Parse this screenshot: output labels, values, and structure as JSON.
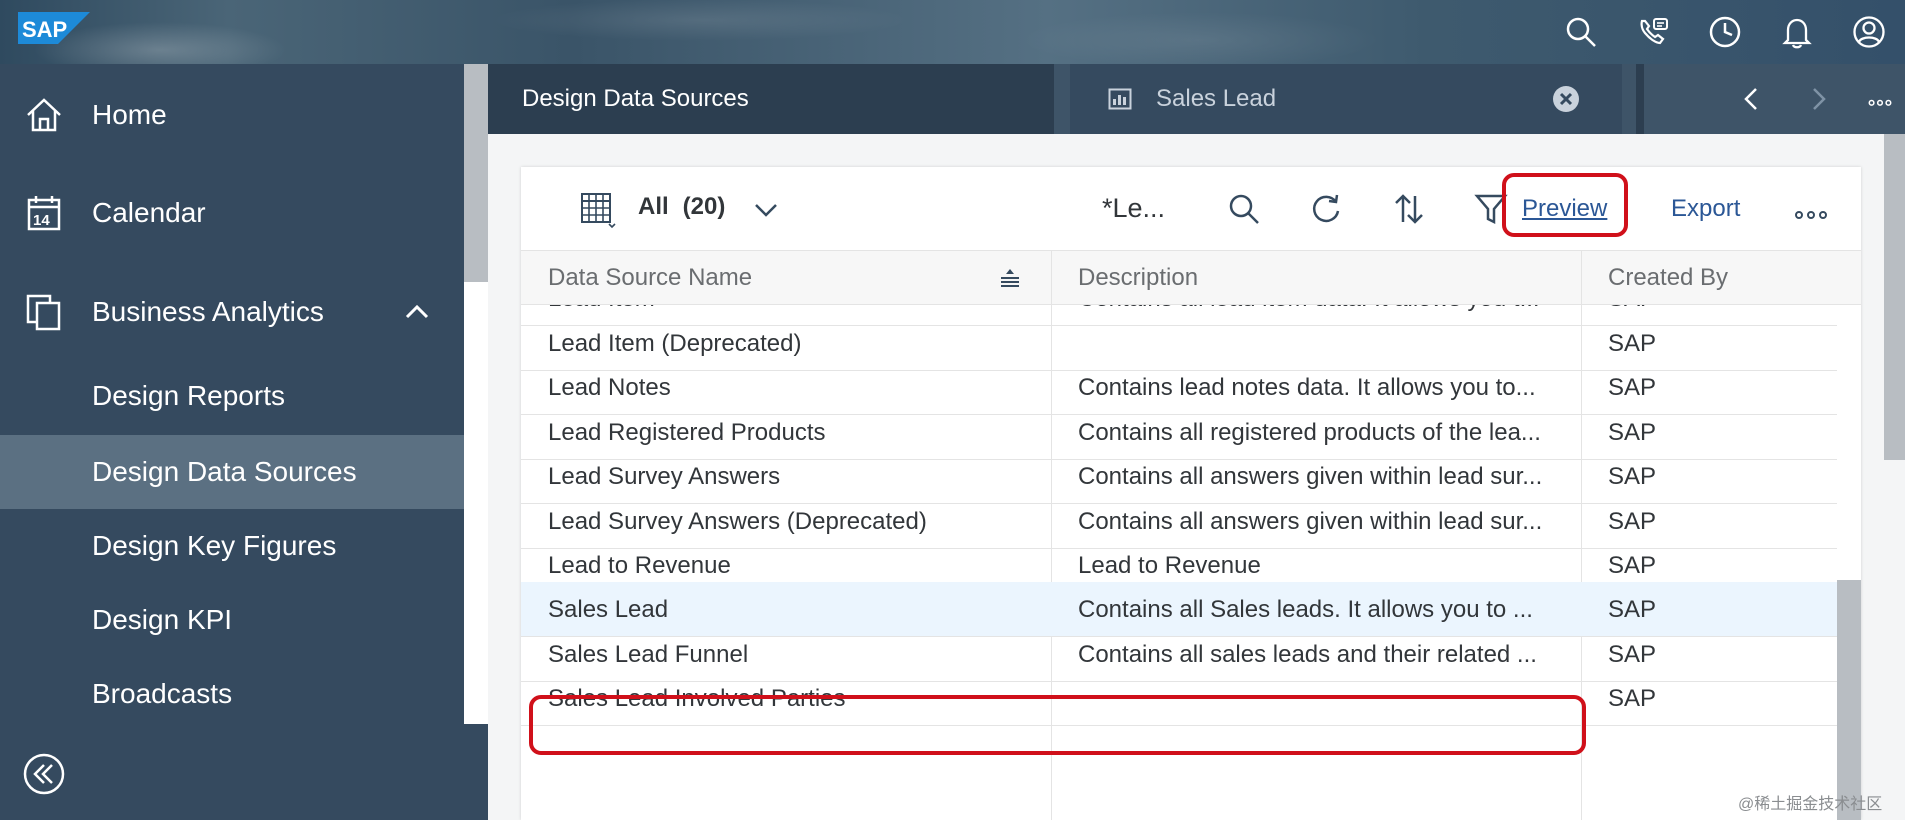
{
  "shell": {
    "logo_text": "SAP",
    "actions": [
      "search-icon",
      "feedback-icon",
      "history-icon",
      "notification-icon",
      "user-icon"
    ]
  },
  "sidebar": {
    "home": "Home",
    "calendar": "Calendar",
    "calendar_icon_day": "14",
    "business_analytics": "Business Analytics",
    "sub_items": [
      "Design Reports",
      "Design Data Sources",
      "Design Key Figures",
      "Design KPI",
      "Broadcasts"
    ],
    "selected": "Design Data Sources"
  },
  "tabs": {
    "active": "Design Data Sources",
    "second": "Sales Lead"
  },
  "toolbar": {
    "variant": "All",
    "count": "(20)",
    "search_text": "*Le...",
    "preview": "Preview",
    "export": "Export"
  },
  "table": {
    "columns": [
      "Data Source Name",
      "Description",
      "Created By"
    ],
    "rows": [
      {
        "name": "Lead Item",
        "description": "Contains all lead item data. It allows you t...",
        "created_by": "SAP"
      },
      {
        "name": "Lead Item (Deprecated)",
        "description": "",
        "created_by": "SAP"
      },
      {
        "name": "Lead Notes",
        "description": "Contains lead notes data. It allows you to...",
        "created_by": "SAP"
      },
      {
        "name": "Lead Registered Products",
        "description": "Contains all registered products of the lea...",
        "created_by": "SAP"
      },
      {
        "name": "Lead Survey Answers",
        "description": "Contains all answers given within lead sur...",
        "created_by": "SAP"
      },
      {
        "name": "Lead Survey Answers (Deprecated)",
        "description": "Contains all answers given within lead sur...",
        "created_by": "SAP"
      },
      {
        "name": "Lead to Revenue",
        "description": "Lead to Revenue",
        "created_by": "SAP"
      },
      {
        "name": "Sales Lead",
        "description": "Contains all Sales leads. It allows you to ...",
        "created_by": "SAP"
      },
      {
        "name": "Sales Lead Funnel",
        "description": "Contains all sales leads and their related ...",
        "created_by": "SAP"
      },
      {
        "name": "Sales Lead Involved Parties",
        "description": "",
        "created_by": "SAP"
      }
    ],
    "selected_row": "Sales Lead"
  },
  "watermark": "@稀土掘金技术社区",
  "colors": {
    "shell": "#354a5f",
    "sidebar": "#354a5f",
    "selected_nav": "#5b7082",
    "link": "#2b5796",
    "highlight": "#d0101a",
    "selected_row": "#ebf5fe"
  }
}
